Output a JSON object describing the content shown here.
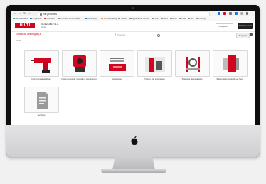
{
  "browser": {
    "url": "hilti.pt/tickets",
    "bookmarks": [
      "Dal-Brasserie",
      "Organizar",
      "Collision",
      "DS Hilti SPRA Media",
      "Marketing",
      "WS Marketing",
      "Tickets",
      "Application center",
      "SAP",
      "BMU",
      "EBS",
      "PSR",
      "SIR",
      "Pricing"
    ]
  },
  "header": {
    "logo_text": "HILTI",
    "account_name": "Conta/a HILTI S.A.",
    "account_sub": "Ideia",
    "language": "Português",
    "cta_label": "Iniciar sessão"
  },
  "toolbar": {
    "link_label": "Gestão de descargas (3)",
    "search_placeholder": "Procurar",
    "button_label": "Registar"
  },
  "breadcrumb": "Início",
  "categories": [
    {
      "label": "Ferramentas elétricas",
      "icon": "power-tool-icon"
    },
    {
      "label": "Instrumentos de medição e nivelamento",
      "icon": "measuring-instrument-icon"
    },
    {
      "label": "Acessórios",
      "icon": "accessories-icon"
    },
    {
      "label": "Produtos de ancoragem",
      "icon": "anchoring-icon"
    },
    {
      "label": "Sistemas de instalação",
      "icon": "installation-system-icon"
    },
    {
      "label": "Sistemas de proteção ao fogo",
      "icon": "fire-protection-icon"
    },
    {
      "label": "Serviços",
      "icon": "services-document-icon"
    }
  ],
  "colors": {
    "brand": "#d2051e",
    "dark": "#222222"
  }
}
